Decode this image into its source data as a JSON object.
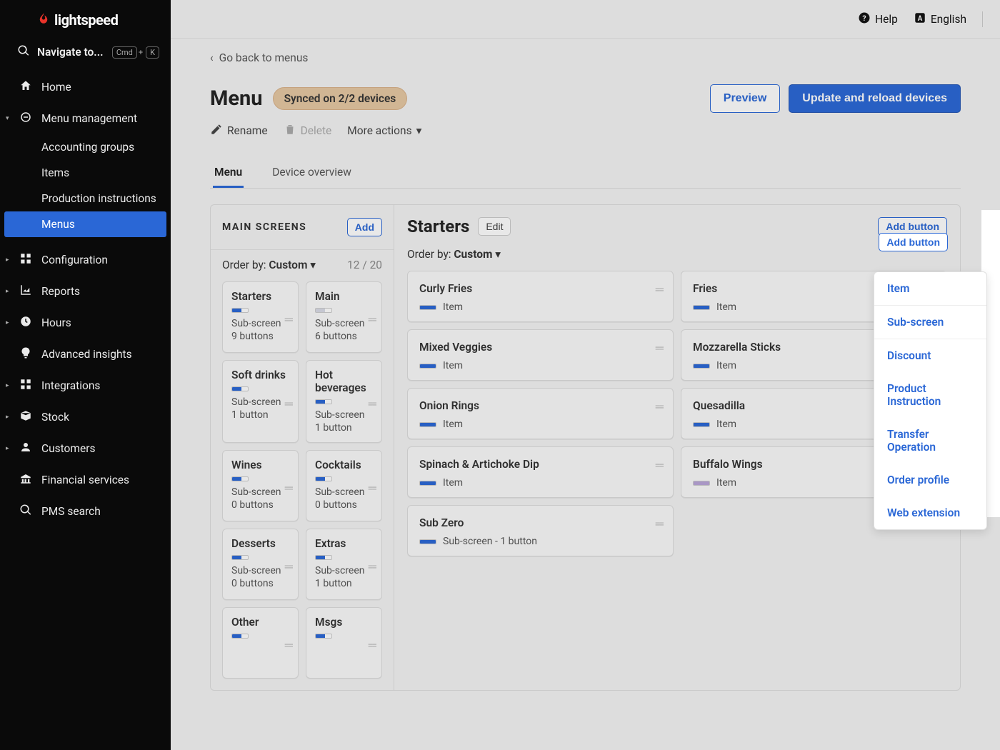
{
  "brand": "lightspeed",
  "nav": {
    "search_label": "Navigate to...",
    "kbd1": "Cmd",
    "kbd_plus": "+",
    "kbd2": "K",
    "home": "Home",
    "menu_mgmt": "Menu management",
    "sub": {
      "accounting": "Accounting groups",
      "items": "Items",
      "production": "Production instructions",
      "menus": "Menus"
    },
    "config": "Configuration",
    "reports": "Reports",
    "hours": "Hours",
    "advanced": "Advanced insights",
    "integrations": "Integrations",
    "stock": "Stock",
    "customers": "Customers",
    "financial": "Financial services",
    "pms": "PMS search"
  },
  "topbar": {
    "help": "Help",
    "lang": "English"
  },
  "back": "Go back to menus",
  "title": "Menu",
  "sync_badge": "Synced on 2/2 devices",
  "buttons": {
    "preview": "Preview",
    "update": "Update and reload devices"
  },
  "actions": {
    "rename": "Rename",
    "delete": "Delete",
    "more": "More actions"
  },
  "tabs": {
    "menu": "Menu",
    "device": "Device overview"
  },
  "main_col": {
    "title": "MAIN SCREENS",
    "add": "Add",
    "orderby_label": "Order by:",
    "orderby_value": "Custom",
    "count": "12 / 20",
    "cards": [
      {
        "title": "Starters",
        "sub": "Sub-screen",
        "extra": "9 buttons",
        "swatch": "blue"
      },
      {
        "title": "Main",
        "sub": "Sub-screen",
        "extra": "6 buttons",
        "swatch": "dim"
      },
      {
        "title": "Soft drinks",
        "sub": "Sub-screen",
        "extra": "1 button",
        "swatch": "blue"
      },
      {
        "title": "Hot beverages",
        "sub": "Sub-screen",
        "extra": "1 button",
        "swatch": "blue"
      },
      {
        "title": "Wines",
        "sub": "Sub-screen",
        "extra": "0 buttons",
        "swatch": "blue"
      },
      {
        "title": "Cocktails",
        "sub": "Sub-screen",
        "extra": "0 buttons",
        "swatch": "blue"
      },
      {
        "title": "Desserts",
        "sub": "Sub-screen",
        "extra": "0 buttons",
        "swatch": "blue"
      },
      {
        "title": "Extras",
        "sub": "Sub-screen",
        "extra": "1 button",
        "swatch": "blue"
      },
      {
        "title": "Other",
        "sub": "",
        "extra": "",
        "swatch": "blue"
      },
      {
        "title": "Msgs",
        "sub": "",
        "extra": "",
        "swatch": "blue"
      }
    ]
  },
  "detail": {
    "title": "Starters",
    "edit": "Edit",
    "add_button": "Add button",
    "orderby_label": "Order by:",
    "orderby_value": "Custom",
    "items_left": [
      {
        "title": "Curly Fries",
        "type": "Item",
        "swatch": "blue"
      },
      {
        "title": "Mixed Veggies",
        "type": "Item",
        "swatch": "blue"
      },
      {
        "title": "Onion Rings",
        "type": "Item",
        "swatch": "blue"
      },
      {
        "title": "Spinach & Artichoke Dip",
        "type": "Item",
        "swatch": "blue"
      },
      {
        "title": "Sub Zero",
        "type": "Sub-screen - 1 button",
        "swatch": "blue"
      }
    ],
    "items_right": [
      {
        "title": "Fries",
        "type": "Item",
        "swatch": "blue"
      },
      {
        "title": "Mozzarella Sticks",
        "type": "Item",
        "swatch": "blue"
      },
      {
        "title": "Quesadilla",
        "type": "Item",
        "swatch": "blue"
      },
      {
        "title": "Buffalo Wings",
        "type": "Item",
        "swatch": "purple"
      }
    ]
  },
  "dropdown": {
    "item": "Item",
    "subscreen": "Sub-screen",
    "discount": "Discount",
    "product_instruction": "Product Instruction",
    "transfer": "Transfer Operation",
    "order_profile": "Order profile",
    "web_ext": "Web extension"
  }
}
